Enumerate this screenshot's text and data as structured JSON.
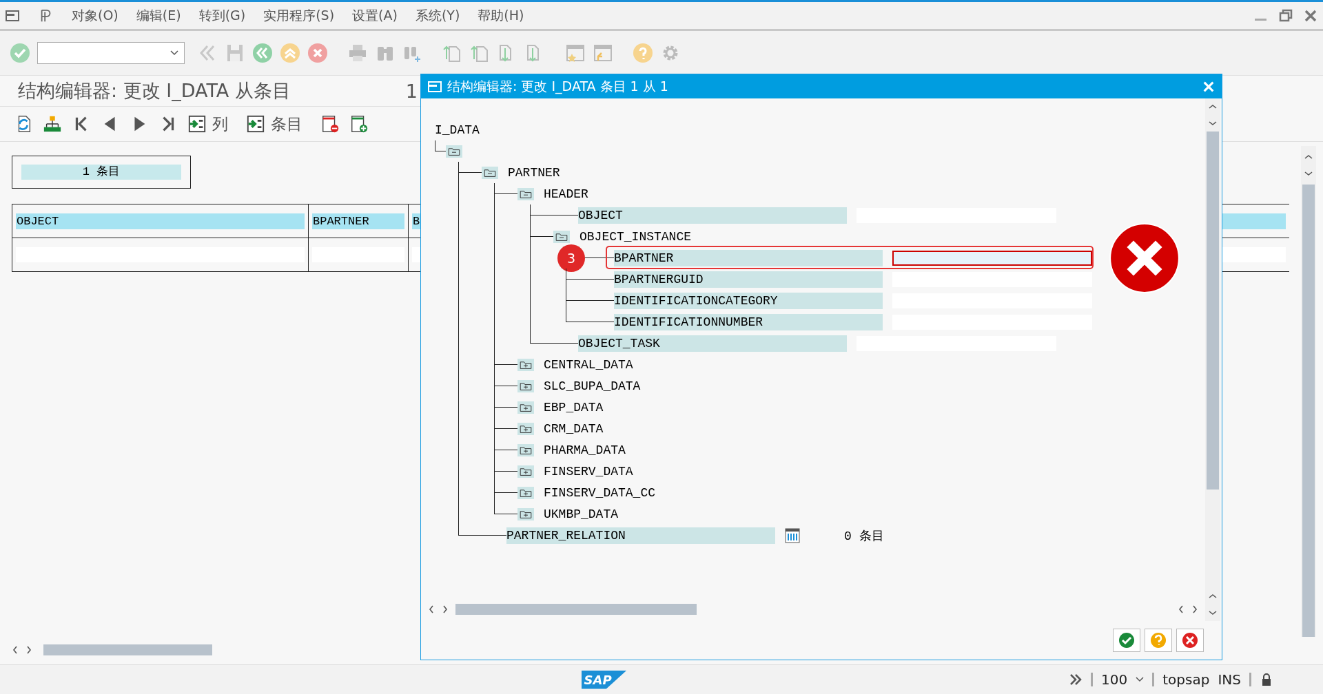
{
  "menu": [
    {
      "label": "对象(O)"
    },
    {
      "label": "编辑(E)"
    },
    {
      "label": "转到(G)"
    },
    {
      "label": "实用程序(S)"
    },
    {
      "label": "设置(A)"
    },
    {
      "label": "系统(Y)"
    },
    {
      "label": "帮助(H)"
    }
  ],
  "screen": {
    "title": "结构编辑器: 更改 I_DATA 从条目",
    "title_suffix": "1",
    "toolbar": [
      {
        "kind": "refresh"
      },
      {
        "kind": "hierarchy"
      },
      {
        "kind": "first"
      },
      {
        "kind": "prev"
      },
      {
        "kind": "next"
      },
      {
        "kind": "last"
      },
      {
        "kind": "labeled",
        "label": "列"
      },
      {
        "kind": "labeled",
        "label": "条目"
      },
      {
        "kind": "delete-row"
      },
      {
        "kind": "insert-row"
      }
    ],
    "entry_count": "1 条目",
    "table": {
      "columns": [
        "OBJECT",
        "BPARTNER",
        "B"
      ]
    }
  },
  "dialog": {
    "title": "结构编辑器: 更改 I_DATA 条目 1 从 1",
    "root": "I_DATA",
    "tree": [
      {
        "kind": "folder",
        "expanded": true,
        "children": [
          {
            "kind": "folder",
            "label": "PARTNER",
            "expanded": true,
            "children": [
              {
                "kind": "folder",
                "label": "HEADER",
                "expanded": true,
                "children": [
                  {
                    "kind": "field",
                    "label": "OBJECT",
                    "highlighted": false
                  },
                  {
                    "kind": "folder",
                    "label": "OBJECT_INSTANCE",
                    "expanded": true,
                    "children": [
                      {
                        "kind": "field",
                        "label": "BPARTNER",
                        "highlighted": true,
                        "marker": "3"
                      },
                      {
                        "kind": "field",
                        "label": "BPARTNERGUID",
                        "highlighted": false
                      },
                      {
                        "kind": "field",
                        "label": "IDENTIFICATIONCATEGORY",
                        "highlighted": false
                      },
                      {
                        "kind": "field",
                        "label": "IDENTIFICATIONNUMBER",
                        "highlighted": false
                      }
                    ]
                  },
                  {
                    "kind": "field",
                    "label": "OBJECT_TASK",
                    "highlighted": false
                  }
                ]
              },
              {
                "kind": "folder",
                "label": "CENTRAL_DATA",
                "expanded": false
              },
              {
                "kind": "folder",
                "label": "SLC_BUPA_DATA",
                "expanded": false
              },
              {
                "kind": "folder",
                "label": "EBP_DATA",
                "expanded": false
              },
              {
                "kind": "folder",
                "label": "CRM_DATA",
                "expanded": false
              },
              {
                "kind": "folder",
                "label": "PHARMA_DATA",
                "expanded": false
              },
              {
                "kind": "folder",
                "label": "FINSERV_DATA",
                "expanded": false
              },
              {
                "kind": "folder",
                "label": "FINSERV_DATA_CC",
                "expanded": false
              },
              {
                "kind": "folder",
                "label": "UKMBP_DATA",
                "expanded": false
              }
            ]
          },
          {
            "kind": "table",
            "label": "PARTNER_RELATION",
            "count": "0 条目"
          }
        ]
      }
    ]
  },
  "status_bar": {
    "logo": "SAP",
    "zoom": "100",
    "system": "topsap",
    "mode": "INS"
  }
}
